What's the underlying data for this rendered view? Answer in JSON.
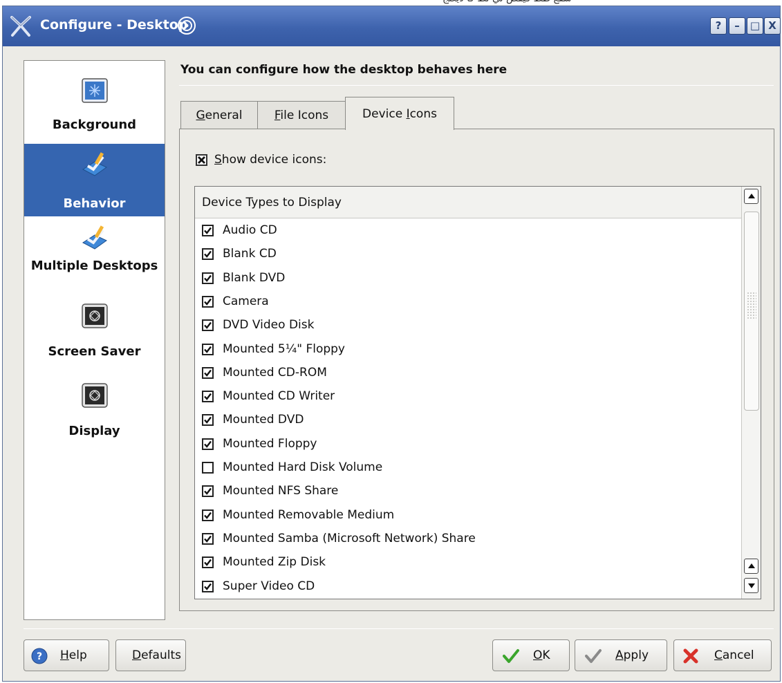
{
  "window": {
    "title": "Configure - Desktop",
    "controls": [
      "?",
      "–",
      "□",
      "X"
    ]
  },
  "sidebar": {
    "items": [
      {
        "label": "Background",
        "icon": "background-icon"
      },
      {
        "label": "Behavior",
        "icon": "behavior-icon",
        "selected": true
      },
      {
        "label": "Multiple Desktops",
        "icon": "multiple-desktops-icon"
      },
      {
        "label": "Screen Saver",
        "icon": "screen-saver-icon"
      },
      {
        "label": "Display",
        "icon": "display-icon"
      }
    ]
  },
  "main": {
    "header": "You can configure how the desktop behaves here",
    "tabs": [
      {
        "label": "General",
        "accel": "G",
        "rest": "eneral"
      },
      {
        "label": "File Icons",
        "accel": "F",
        "rest": "ile Icons"
      },
      {
        "label": "Device Icons",
        "pre": "Device ",
        "accel": "I",
        "rest": "cons",
        "active": true
      }
    ],
    "show_device_icons": {
      "accel": "S",
      "rest": "how device icons:",
      "checked": true
    },
    "device_list": {
      "header": "Device Types to Display",
      "items": [
        {
          "label": "Audio CD",
          "checked": true
        },
        {
          "label": "Blank CD",
          "checked": true
        },
        {
          "label": "Blank DVD",
          "checked": true
        },
        {
          "label": "Camera",
          "checked": true
        },
        {
          "label": "DVD Video Disk",
          "checked": true
        },
        {
          "label": "Mounted 5¼\" Floppy",
          "checked": true
        },
        {
          "label": "Mounted CD-ROM",
          "checked": true
        },
        {
          "label": "Mounted CD Writer",
          "checked": true
        },
        {
          "label": "Mounted DVD",
          "checked": true
        },
        {
          "label": "Mounted Floppy",
          "checked": true
        },
        {
          "label": "Mounted Hard Disk Volume",
          "checked": false
        },
        {
          "label": "Mounted NFS Share",
          "checked": true
        },
        {
          "label": "Mounted Removable Medium",
          "checked": true
        },
        {
          "label": "Mounted Samba (Microsoft Network) Share",
          "checked": true
        },
        {
          "label": "Mounted Zip Disk",
          "checked": true
        },
        {
          "label": "Super Video CD",
          "checked": true
        }
      ]
    }
  },
  "buttons": {
    "help": {
      "accel": "H",
      "rest": "elp"
    },
    "defaults": {
      "accel": "D",
      "rest": "efaults"
    },
    "ok": {
      "accel": "O",
      "rest": "K"
    },
    "apply": {
      "accel": "A",
      "rest": "pply"
    },
    "cancel": {
      "accel": "C",
      "rest": "ancel"
    }
  },
  "colors": {
    "titlebar": "#3e63ad",
    "selection": "#3565b0",
    "window_bg": "#ecebe6"
  }
}
